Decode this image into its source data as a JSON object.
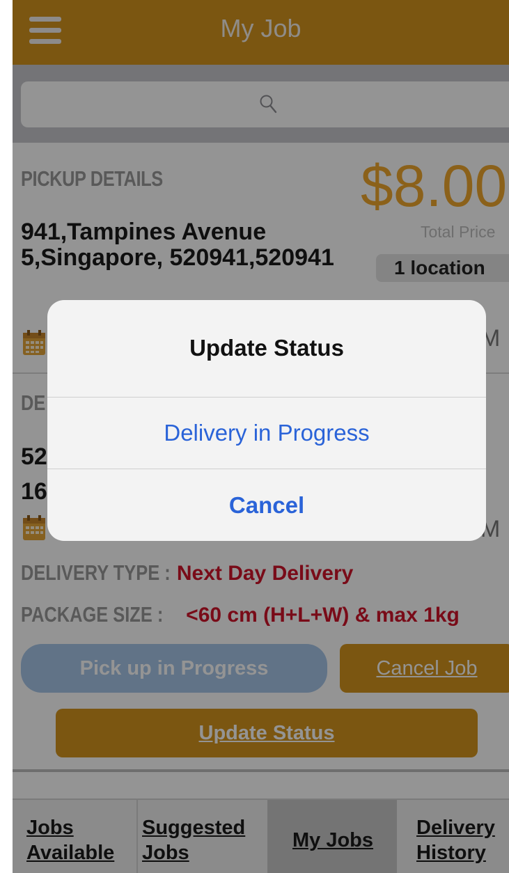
{
  "header": {
    "title": "My Job",
    "menu_icon": "hamburger-menu-icon",
    "background_color": "#d4951e"
  },
  "search": {
    "icon": "search-icon",
    "placeholder": ""
  },
  "job": {
    "pickup_label": "PICKUP DETAILS",
    "pickup_address": "941,Tampines Avenue 5,Singapore, 520941,520941",
    "pickup_time_tail": "M",
    "price": "$8.00",
    "price_label": "Total Price",
    "location_badge": "1 location",
    "delivery_label": "DE",
    "delivery_address_line1": "52",
    "delivery_address_line2": "16",
    "delivery_time_tail": "M",
    "delivery_type_key": "DELIVERY TYPE : ",
    "delivery_type_value": "Next Day Delivery",
    "package_size_key": "PACKAGE SIZE : ",
    "package_size_value": "<60 cm (H+L+W) & max 1kg",
    "status_color": "#d0142a",
    "calendar_icon": "calendar-icon",
    "clock_icon": "clock-icon"
  },
  "actions": {
    "pickup_progress": "Pick up in Progress",
    "cancel_job": "Cancel Job",
    "update_status": "Update Status"
  },
  "tabs": [
    {
      "line1": "Jobs",
      "line2": "Available"
    },
    {
      "line1": "Suggested",
      "line2": "Jobs"
    },
    {
      "line1": "My Jobs",
      "line2": ""
    },
    {
      "line1": "Delivery",
      "line2": "History"
    }
  ],
  "alert": {
    "title": "Update Status",
    "action": "Delivery in Progress",
    "cancel": "Cancel",
    "action_color": "#2a63d8"
  }
}
